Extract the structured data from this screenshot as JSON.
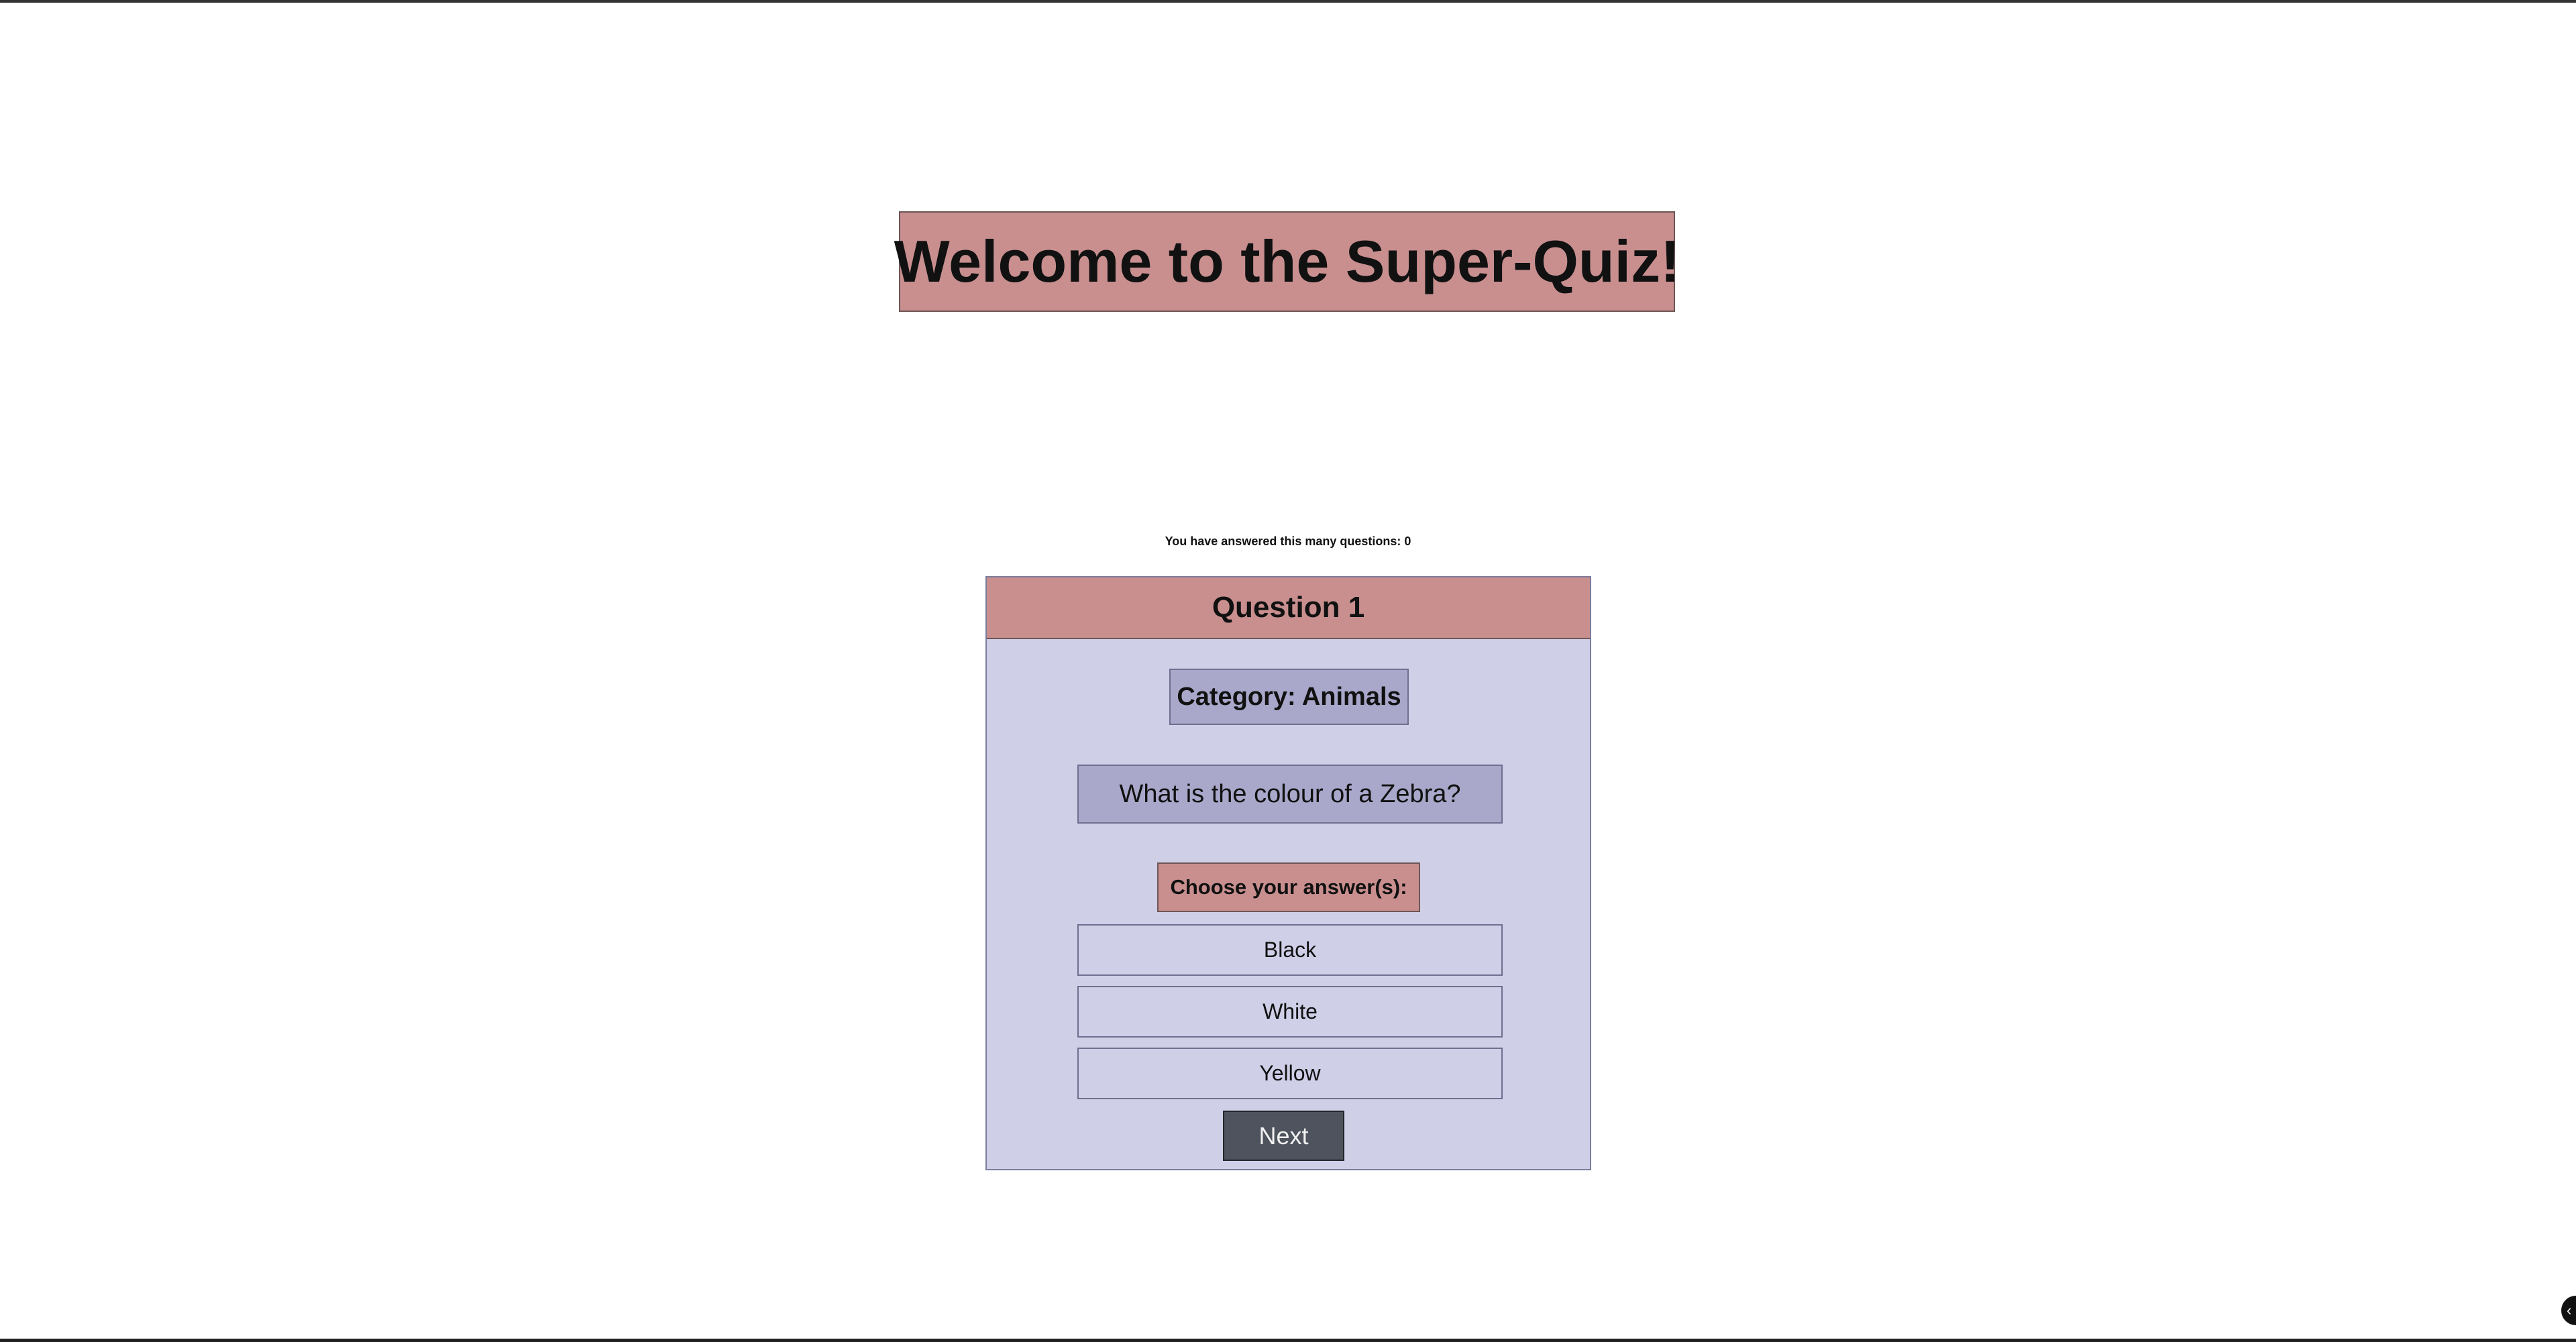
{
  "header": {
    "title": "Welcome to the Super-Quiz!"
  },
  "progress": {
    "answered_text": "You have answered this many questions: 0"
  },
  "quiz": {
    "question_heading": "Question 1",
    "category": "Category: Animals",
    "question": "What is the colour of a Zebra?",
    "choose_label": "Choose your answer(s):",
    "answers": [
      "Black",
      "White",
      "Yellow"
    ],
    "next_label": "Next"
  },
  "colors": {
    "accent_rose": "#c98f8f",
    "card_lavender": "#d0cfe8",
    "badge_purple": "#a9a7ca",
    "button_dark": "#4e535d"
  },
  "icons": {
    "corner_control": "chevron-icon"
  }
}
